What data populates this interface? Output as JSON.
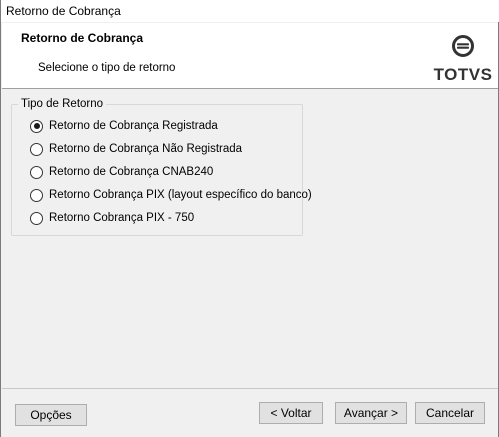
{
  "window": {
    "title": "Retorno de Cobrança"
  },
  "header": {
    "title": "Retorno de Cobrança",
    "subtitle": "Selecione o tipo de retorno",
    "logo_text": "TOTVS"
  },
  "group": {
    "legend": "Tipo de Retorno",
    "options": [
      {
        "label": "Retorno de Cobrança Registrada",
        "checked": true
      },
      {
        "label": "Retorno de Cobrança Não Registrada",
        "checked": false
      },
      {
        "label": "Retorno de Cobrança CNAB240",
        "checked": false
      },
      {
        "label": "Retorno Cobrança PIX (layout específico do banco)",
        "checked": false
      },
      {
        "label": "Retorno Cobrança PIX - 750",
        "checked": false
      }
    ]
  },
  "buttons": {
    "options": "Opções",
    "back": "< Voltar",
    "next": "Avançar >",
    "cancel": "Cancelar"
  },
  "icons": {
    "logo": "totvs-logo-icon",
    "radio": "radio-icon"
  }
}
